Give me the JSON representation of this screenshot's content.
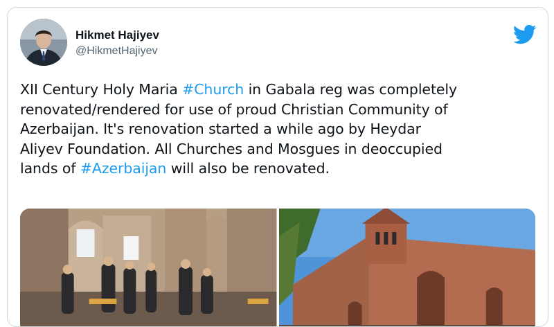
{
  "author": {
    "name": "Hikmet Hajiyev",
    "handle": "@HikmetHajiyev"
  },
  "icons": {
    "brand": "twitter-bird-icon",
    "brand_color": "#1d9bf0"
  },
  "tweet": {
    "l1_a": "XII Century Holy Maria ",
    "tag1": "#Church",
    "l1_b": " in Gabala reg was completely",
    "l2": "renovated/rendered for use of proud Christian Community of",
    "l3": "Azerbaijan. It's renovation started a while ago by Heydar",
    "l4": "Aliyev Foundation. All Churches and Mosgues in deoccupied",
    "l5_a": "lands of ",
    "tag2": "#Azerbaijan",
    "l5_b": " will also be renovated."
  },
  "media": {
    "photos": [
      "church-interior-photo",
      "church-exterior-photo"
    ]
  }
}
